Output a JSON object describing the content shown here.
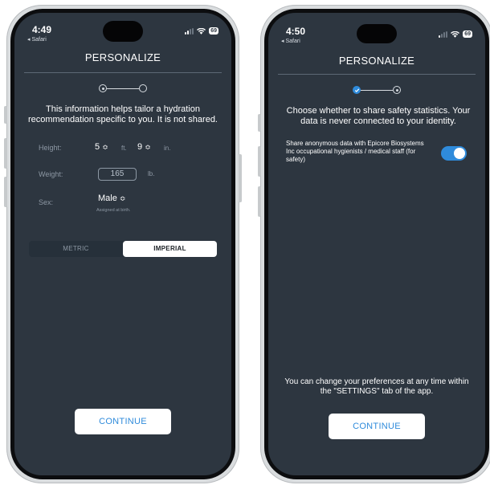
{
  "left": {
    "time": "4:49",
    "back": "◂ Safari",
    "battery": "69",
    "title": "PERSONALIZE",
    "intro": "This information helps tailor a hydration recommendation specific to you. It is not shared.",
    "height_label": "Height:",
    "height_ft": "5",
    "ft_unit": "ft.",
    "height_in": "9",
    "in_unit": "in.",
    "weight_label": "Weight:",
    "weight_value": "165",
    "weight_unit": "lb.",
    "sex_label": "Sex:",
    "sex_value": "Male",
    "sex_hint": "Assigned at birth.",
    "metric_label": "METRIC",
    "imperial_label": "IMPERIAL",
    "selected_unit_system": "IMPERIAL",
    "continue_label": "CONTINUE"
  },
  "right": {
    "time": "4:50",
    "back": "◂ Safari",
    "battery": "69",
    "title": "PERSONALIZE",
    "intro": "Choose whether to share safety statistics. Your data is never connected to your identity.",
    "share_text": "Share anonymous data with Epicore Biosystems Inc occupational hygienists / medical staff  (for safety)",
    "share_enabled": true,
    "footer": "You can change your preferences at any time within the \"SETTINGS\" tab of the app.",
    "continue_label": "CONTINUE"
  },
  "colors": {
    "screen_bg": "#2d3640",
    "accent": "#2f8bdb",
    "muted_text": "#8d98a4"
  },
  "icons": [
    "chevron-up-down-icon",
    "wifi-icon",
    "signal-icon",
    "battery-icon",
    "checkmark-icon"
  ]
}
